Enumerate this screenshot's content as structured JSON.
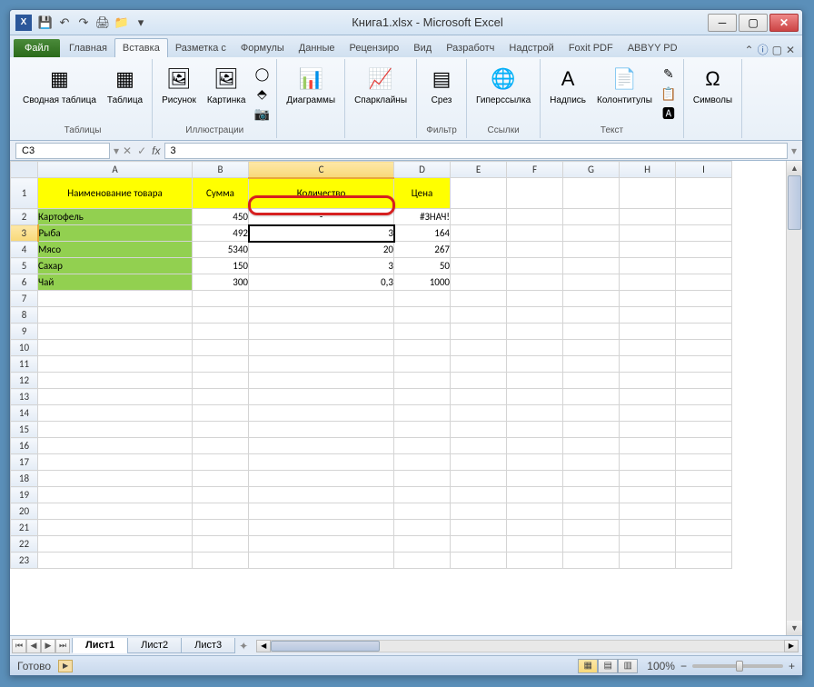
{
  "window": {
    "title": "Книга1.xlsx - Microsoft Excel"
  },
  "qat": [
    "💾",
    "↶",
    "↷",
    "🖨",
    "📁"
  ],
  "tabs": {
    "file": "Файл",
    "list": [
      "Главная",
      "Вставка",
      "Разметка с",
      "Формулы",
      "Данные",
      "Рецензиро",
      "Вид",
      "Разработч",
      "Надстрой",
      "Foxit PDF",
      "ABBYY PD"
    ],
    "active": 1
  },
  "ribbon": {
    "groups": [
      {
        "title": "Таблицы",
        "items": [
          {
            "ico": "▦",
            "lbl": "Сводная\nтаблица"
          },
          {
            "ico": "▦",
            "lbl": "Таблица"
          }
        ]
      },
      {
        "title": "Иллюстрации",
        "items": [
          {
            "ico": "🖼",
            "lbl": "Рисунок"
          },
          {
            "ico": "🖼",
            "lbl": "Картинка"
          }
        ],
        "side": [
          "◯",
          "⬘",
          "📷"
        ]
      },
      {
        "title": "",
        "items": [
          {
            "ico": "📊",
            "lbl": "Диаграммы"
          }
        ]
      },
      {
        "title": "",
        "items": [
          {
            "ico": "📈",
            "lbl": "Спарклайны"
          }
        ]
      },
      {
        "title": "Фильтр",
        "items": [
          {
            "ico": "▤",
            "lbl": "Срез"
          }
        ]
      },
      {
        "title": "Ссылки",
        "items": [
          {
            "ico": "🌐",
            "lbl": "Гиперссылка"
          }
        ]
      },
      {
        "title": "Текст",
        "items": [
          {
            "ico": "A",
            "lbl": "Надпись"
          },
          {
            "ico": "📄",
            "lbl": "Колонтитулы"
          }
        ],
        "side": [
          "✎",
          "📋",
          "🅰"
        ]
      },
      {
        "title": "",
        "items": [
          {
            "ico": "Ω",
            "lbl": "Символы"
          }
        ]
      }
    ]
  },
  "namebox": "C3",
  "formula": "3",
  "columns": [
    "A",
    "B",
    "C",
    "D",
    "E",
    "F",
    "G",
    "H",
    "I"
  ],
  "headers": {
    "A": "Наименование товара",
    "B": "Сумма",
    "C": "Количество",
    "D": "Цена"
  },
  "rows": [
    {
      "n": "2",
      "A": "Картофель",
      "B": "450",
      "C": "-",
      "D": "#ЗНАЧ!",
      "g": true
    },
    {
      "n": "3",
      "A": "Рыба",
      "B": "492",
      "C": "3",
      "D": "164",
      "g": true,
      "sel": true
    },
    {
      "n": "4",
      "A": "Мясо",
      "B": "5340",
      "C": "20",
      "D": "267",
      "g": true
    },
    {
      "n": "5",
      "A": "Сахар",
      "B": "150",
      "C": "3",
      "D": "50",
      "g": true
    },
    {
      "n": "6",
      "A": "Чай",
      "B": "300",
      "C": "0,3",
      "D": "1000",
      "g": true
    }
  ],
  "emptyRows": [
    "7",
    "8",
    "9",
    "10",
    "11",
    "12",
    "13",
    "14",
    "15",
    "16",
    "17",
    "18",
    "19",
    "20",
    "21",
    "22",
    "23"
  ],
  "sheets": {
    "list": [
      "Лист1",
      "Лист2",
      "Лист3"
    ],
    "active": 0
  },
  "status": {
    "ready": "Готово",
    "zoom": "100%"
  }
}
